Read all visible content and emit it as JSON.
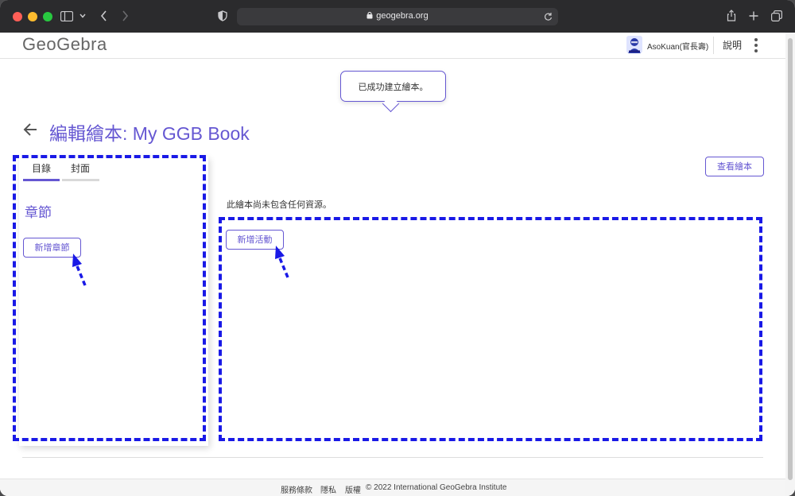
{
  "browser": {
    "url": "geogebra.org",
    "colors": {
      "close": "#ff5f57",
      "minimize": "#febc2e",
      "maximize": "#28c840"
    },
    "icons": [
      "sidebar-icon",
      "chevron-down-icon",
      "back-icon",
      "forward-icon",
      "shield-icon",
      "lock-icon",
      "reload-icon",
      "share-icon",
      "new-tab-icon",
      "tabs-overview-icon"
    ]
  },
  "header": {
    "logo": "GeoGebra",
    "user_name": "AsoKuan(官長壽)",
    "help_label": "說明",
    "icons": [
      "avatar",
      "more-vertical-icon"
    ]
  },
  "toast": {
    "message": "已成功建立繪本。"
  },
  "main": {
    "title": "編輯繪本: My GGB Book",
    "view_book_label": "查看繪本",
    "tabs": [
      {
        "label": "目錄",
        "active": true
      },
      {
        "label": "封面",
        "active": false
      }
    ],
    "chapters_heading": "章節",
    "add_chapter_label": "新增章節",
    "empty_message": "此繪本尚未包含任何資源。",
    "add_activity_label": "新增活動"
  },
  "annotations": {
    "highlight_color": "#1919e6",
    "accent_color": "#6557d2"
  },
  "footer": {
    "terms": "服務條款",
    "privacy": "隱私",
    "copyright_label": "版權",
    "copyright_text": "© 2022 International GeoGebra Institute"
  }
}
